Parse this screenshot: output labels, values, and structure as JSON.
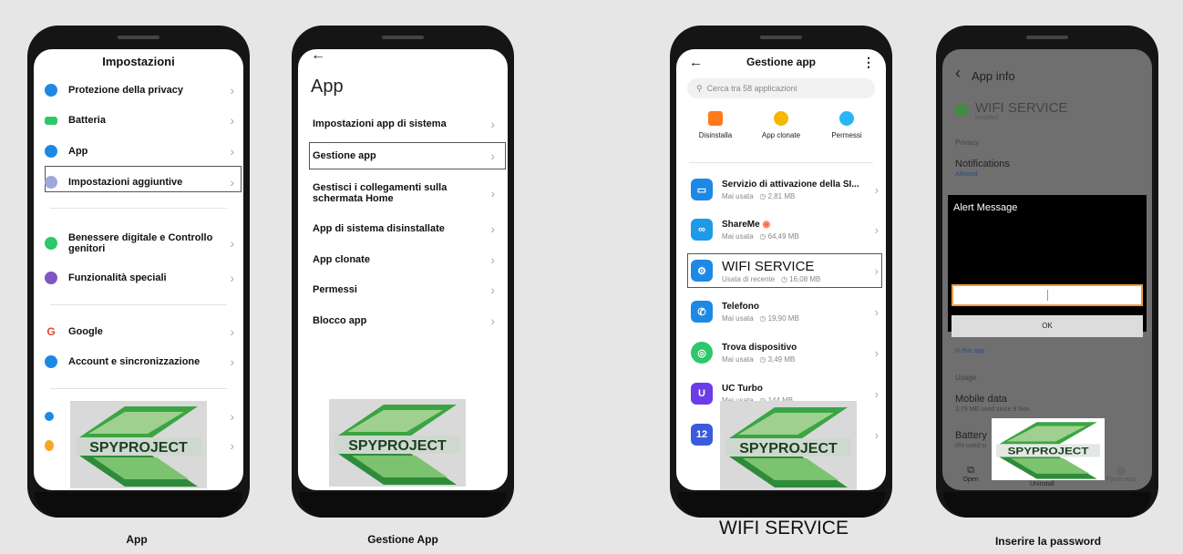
{
  "screens": {
    "s1": {
      "title": "Impostazioni",
      "items": [
        {
          "label": "Protezione della privacy",
          "color": "#1e88e5"
        },
        {
          "label": "Batteria",
          "color": "#2ec76a"
        },
        {
          "label": "App",
          "color": "#1e88e5"
        },
        {
          "label": "Impostazioni aggiuntive",
          "color": "#9fa8da"
        },
        {
          "label": "Benessere digitale e Controllo genitori",
          "color": "#2ec76a"
        },
        {
          "label": "Funzionalità speciali",
          "color": "#7e57c2"
        },
        {
          "label": "Google",
          "color": "#ea4335"
        },
        {
          "label": "Account e sincronizzazione",
          "color": "#1e88e5"
        }
      ],
      "caption": "App"
    },
    "s2": {
      "back": "←",
      "title": "App",
      "items": [
        "Impostazioni app di sistema",
        "Gestione app",
        "Gestisci i collegamenti sulla schermata Home",
        "App di sistema disinstallate",
        "App clonate",
        "Permessi",
        "Blocco app"
      ],
      "caption": "Gestione App"
    },
    "s3": {
      "back": "←",
      "title": "Gestione app",
      "menu": "⋮",
      "search_placeholder": "Cerca tra 58 applicazioni",
      "actions": [
        {
          "label": "Disinstalla",
          "color": "#ff7a1a"
        },
        {
          "label": "App clonate",
          "color": "#f5b800"
        },
        {
          "label": "Permessi",
          "color": "#29b6f6"
        }
      ],
      "apps": [
        {
          "name": "Servizio di attivazione della SI...",
          "usage": "Mai usata",
          "size": "◷ 2,81 MB",
          "color": "#1e88e5",
          "glyph": "▭"
        },
        {
          "name": "ShareMe",
          "usage": "Mai usata",
          "size": "◷ 64,49 MB",
          "color": "#1e9be8",
          "glyph": "∞"
        },
        {
          "name": "WIFI SERVICE",
          "usage": "Usata di recente",
          "size": "◷ 16,08 MB",
          "color": "#1e88e5",
          "glyph": "⚙"
        },
        {
          "name": "Telefono",
          "usage": "Mai usata",
          "size": "◷ 19,90 MB",
          "color": "#1e88e5",
          "glyph": "✆"
        },
        {
          "name": "Trova dispositivo",
          "usage": "Mai usata",
          "size": "◷ 3,49 MB",
          "color": "#2ec76a",
          "glyph": "◎"
        },
        {
          "name": "UC Turbo",
          "usage": "Mai usata",
          "size": "◷ 144 MB",
          "color": "#6a3de8",
          "glyph": "U"
        },
        {
          "name": "",
          "usage": "",
          "size": "",
          "color": "#3b5bdb",
          "glyph": "12"
        }
      ],
      "caption": "WIFI SERVICE"
    },
    "s4": {
      "back": "‹",
      "title": "App info",
      "app_name": "WIFI SERVICE",
      "installed": "installed",
      "privacy": "Privacy",
      "notifications": "Notifications",
      "allowed": "Allowed",
      "alert_title": "Alert Message",
      "ok": "OK",
      "in_this_app": "In this app",
      "usage": "Usage",
      "mobile_data": "Mobile data",
      "mobile_data_sub": "3.79 MB used since 9 Nov",
      "battery": "Battery",
      "battery_sub": "0% used si",
      "open": "Open",
      "uninstall": "Uninstall",
      "force_stop": "Force stop",
      "caption": "Inserire la password"
    }
  },
  "logo": "SPYPROJECT",
  "colors": {
    "logo_green": "#3aa542",
    "logo_light": "#9fd08f",
    "logo_dark": "#1f6b2a",
    "highlight": "#555555"
  }
}
